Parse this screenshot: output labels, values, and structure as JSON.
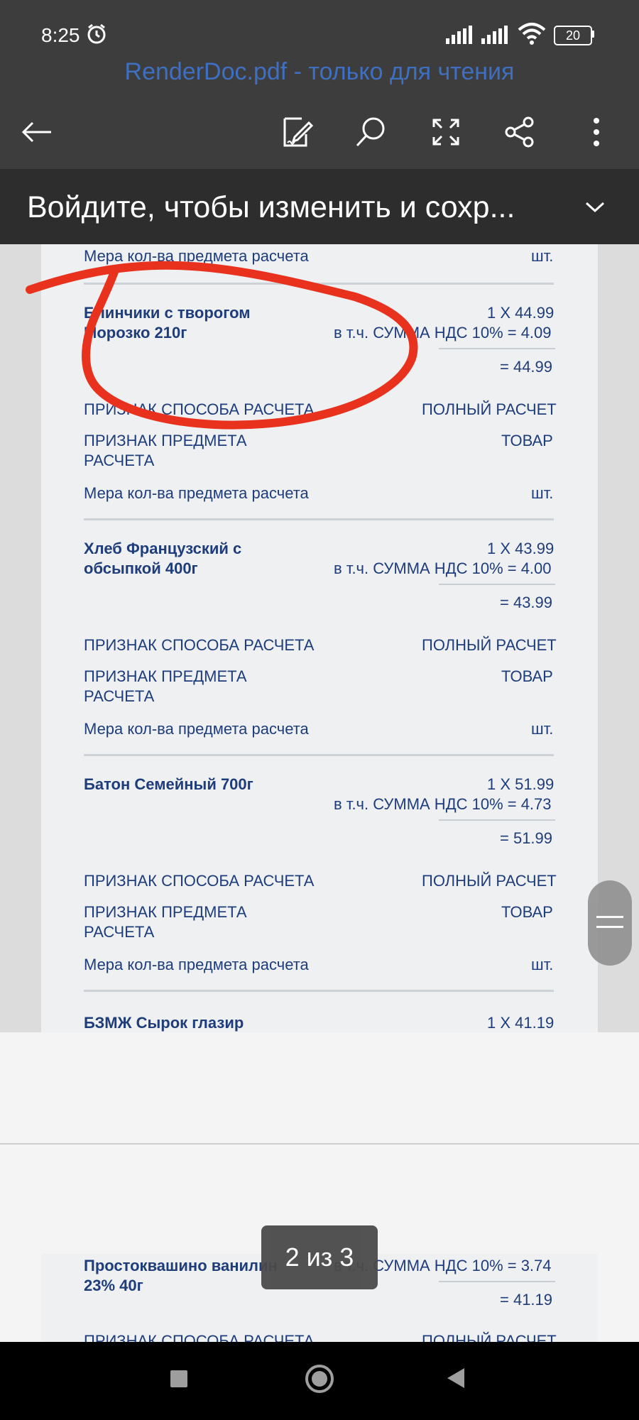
{
  "status_bar": {
    "time": "8:25",
    "battery": "20",
    "icons": [
      "alarm-icon",
      "signal-icon",
      "signal-icon",
      "wifi-icon",
      "battery-icon"
    ]
  },
  "app_bar": {
    "title": "RenderDoc.pdf - только для чтения",
    "title_color": "#3f6fc1",
    "background": "#3d3d3d",
    "icons": [
      "back-arrow-icon",
      "edit-icon",
      "search-icon",
      "fullscreen-icon",
      "share-icon",
      "more-icon"
    ]
  },
  "signin_banner": {
    "text": "Войдите, чтобы изменить и сохр..."
  },
  "receipt": {
    "text_color": "#1f3d7a",
    "top_measure": {
      "label": "Мера кол-ва предмета расчета",
      "value": "шт."
    },
    "items": [
      {
        "name_line1": "Блинчики с творогом",
        "name_line2": "Морозко 210г",
        "qty_price": "1 X 44.99",
        "vat": "в т.ч. СУММА НДС 10% = 4.09",
        "total": "= 44.99",
        "payment_method_label": "ПРИЗНАК СПОСОБА РАСЧЕТА",
        "payment_method_value": "ПОЛНЫЙ РАСЧЕТ",
        "subject_label_line1": "ПРИЗНАК ПРЕДМЕТА",
        "subject_label_line2": "РАСЧЕТА",
        "subject_value": "ТОВАР",
        "measure_label": "Мера кол-ва предмета расчета",
        "measure_value": "шт."
      },
      {
        "name_line1": "Хлеб Французский с",
        "name_line2": "обсыпкой 400г",
        "qty_price": "1 X 43.99",
        "vat": "в т.ч. СУММА НДС 10% = 4.00",
        "total": "= 43.99",
        "payment_method_label": "ПРИЗНАК СПОСОБА РАСЧЕТА",
        "payment_method_value": "ПОЛНЫЙ РАСЧЕТ",
        "subject_label_line1": "ПРИЗНАК ПРЕДМЕТА",
        "subject_label_line2": "РАСЧЕТА",
        "subject_value": "ТОВАР",
        "measure_label": "Мера кол-ва предмета расчета",
        "measure_value": "шт."
      },
      {
        "name_line1": "Батон Семейный 700г",
        "qty_price": "1 X 51.99",
        "vat": "в т.ч. СУММА НДС 10% = 4.73",
        "total": "= 51.99",
        "payment_method_label": "ПРИЗНАК СПОСОБА РАСЧЕТА",
        "payment_method_value": "ПОЛНЫЙ РАСЧЕТ",
        "subject_label_line1": "ПРИЗНАК ПРЕДМЕТА",
        "subject_label_line2": "РАСЧЕТА",
        "subject_value": "ТОВАР",
        "measure_label": "Мера кол-ва предмета расчета",
        "measure_value": "шт."
      },
      {
        "name_line1": "БЗМЖ Сырок глазир",
        "qty_price": "1 X 41.19"
      }
    ],
    "next_page_item": {
      "name_line1": "Простоквашино ванилин",
      "name_line2": "23% 40г",
      "vat": "в т.ч. СУММА НДС 10% = 3.74",
      "total": "= 41.19",
      "payment_method_label": "ПРИЗНАК СПОСОБА РАСЧЕТА",
      "payment_method_value": "ПОЛНЫЙ РАСЧЕТ"
    }
  },
  "annotation": {
    "color": "#e8321e"
  },
  "page_indicator": "2 из 3",
  "nav_bar": {
    "icons": [
      "recents-square-icon",
      "home-circle-icon",
      "back-triangle-icon"
    ]
  }
}
